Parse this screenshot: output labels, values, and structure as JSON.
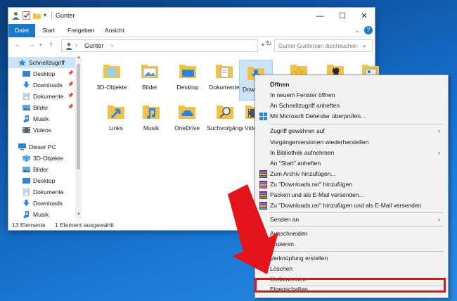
{
  "window": {
    "title": "Gunter",
    "min_icon": "minimize-icon",
    "max_icon": "maximize-icon",
    "close_icon": "close-icon"
  },
  "ribbon": {
    "tabs": [
      "Datei",
      "Start",
      "Freigeben",
      "Ansicht"
    ],
    "accent": "#1979ca"
  },
  "address": {
    "path": "Gunter",
    "search_placeholder": "Gunter Guntersen durchsuchen"
  },
  "nav": {
    "items": [
      {
        "label": "Schnellzugriff",
        "icon": "star-icon"
      },
      {
        "label": "Desktop",
        "icon": "desktop-icon",
        "pinned": true
      },
      {
        "label": "Downloads",
        "icon": "download-icon",
        "pinned": true
      },
      {
        "label": "Dokumente",
        "icon": "document-icon",
        "pinned": true
      },
      {
        "label": "Bilder",
        "icon": "pictures-icon",
        "pinned": true
      },
      {
        "label": "Musik",
        "icon": "music-icon"
      },
      {
        "label": "Videos",
        "icon": "video-icon"
      },
      {
        "label": "Dieser PC",
        "icon": "computer-icon"
      },
      {
        "label": "3D-Objekte",
        "icon": "3d-objects-icon"
      },
      {
        "label": "Bilder",
        "icon": "pictures-icon"
      },
      {
        "label": "Desktop",
        "icon": "desktop-icon"
      },
      {
        "label": "Dokumente",
        "icon": "document-icon"
      },
      {
        "label": "Downloads",
        "icon": "download-icon"
      },
      {
        "label": "Musik",
        "icon": "music-icon"
      }
    ]
  },
  "files": {
    "row1": [
      "3D-Objekte",
      "Bilder",
      "Desktop",
      "Dokumente",
      "Downloads",
      "",
      "",
      ""
    ],
    "row2": [
      "Links",
      "Musik",
      "OneDrive",
      "Suchvorgänge",
      "Videos"
    ]
  },
  "status": {
    "count": "13 Elemente",
    "selected": "1 Element ausgewählt"
  },
  "context_menu": {
    "items": [
      "Öffnen",
      "In neuem Fenster öffnen",
      "An Schnellzugriff anheften",
      "Mit Microsoft Defender überprüfen...",
      "Zugriff gewähren auf",
      "Vorgängerversionen wiederherstellen",
      "In Bibliothek aufnehmen",
      "An \"Start\" anheften",
      "Zum Archiv hinzufügen...",
      "Zu \"Downloads.rar\" hinzufügen",
      "Packen und als E-Mail versenden...",
      "Zu \"Downloads.rar\" hinzufügen und als E-Mail versenden",
      "Senden an",
      "Ausschneiden",
      "Kopieren",
      "Verknüpfung erstellen",
      "Löschen",
      "Umbenennen",
      "Eigenschaften"
    ],
    "highlight_color": "#e3131b"
  }
}
